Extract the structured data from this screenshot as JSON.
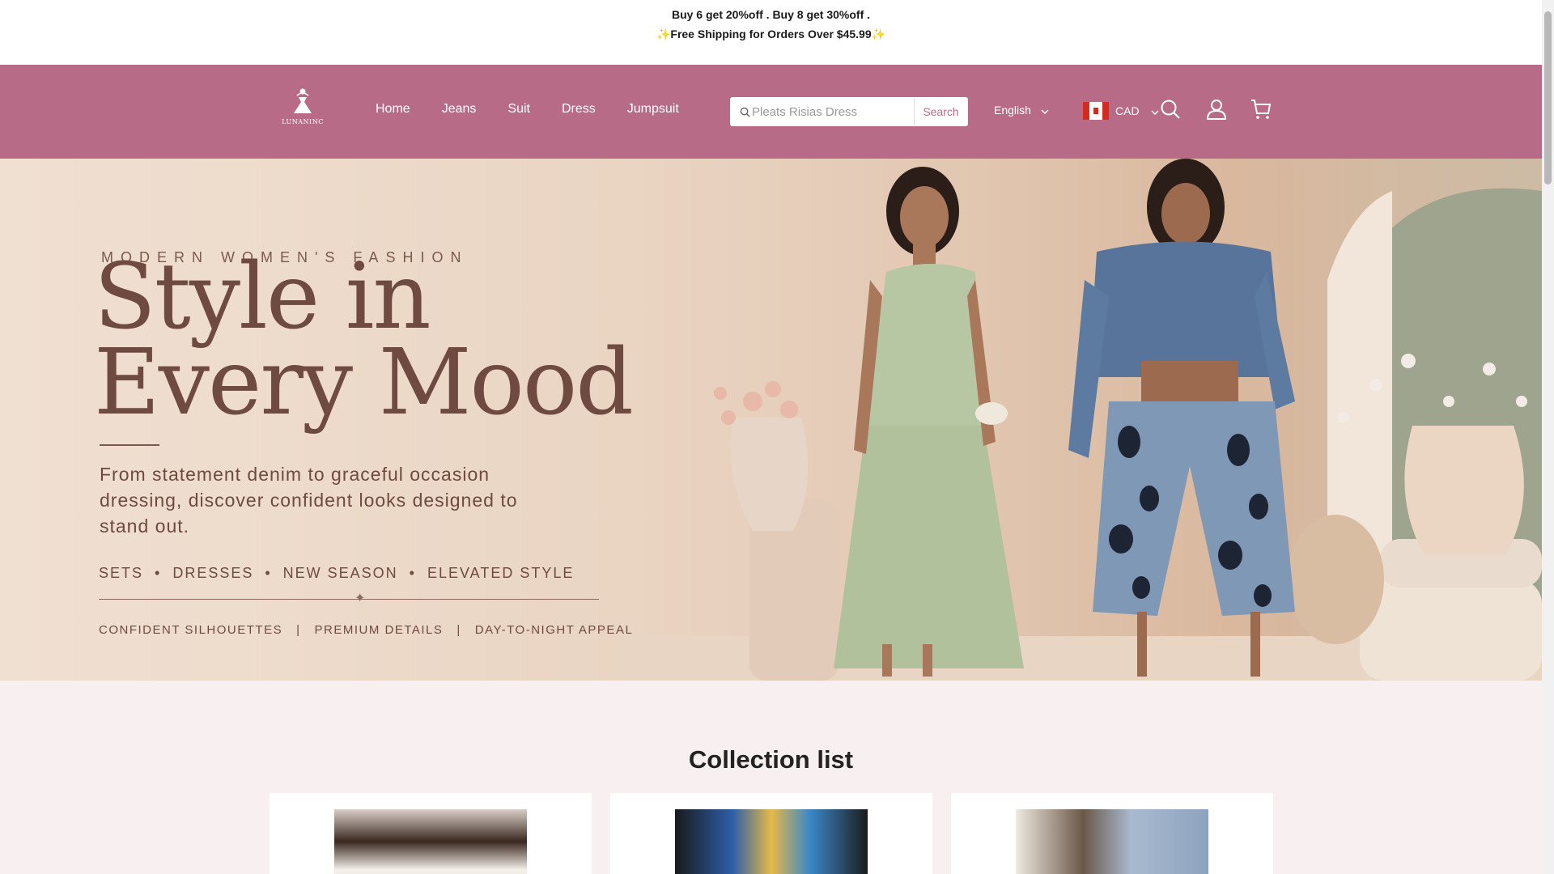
{
  "announcement": {
    "line1": "Buy 6 get 20%off . Buy 8 get 30%off .",
    "line2": "✨Free Shipping for Orders Over $45.99✨"
  },
  "header": {
    "logo_text": "LUNANINC",
    "nav": [
      "Home",
      "Jeans",
      "Suit",
      "Dress",
      "Jumpsuit"
    ],
    "search_placeholder": "Pleats Risias Dress",
    "search_button": "Search",
    "language": "English",
    "currency": "CAD",
    "colors": {
      "header_bg": "#b86b86"
    }
  },
  "hero": {
    "eyebrow": "MODERN WOMEN'S FASHION",
    "title_line1": "Style in",
    "title_line2": "Every Mood",
    "subtitle": "From statement denim to graceful occasion dressing, discover confident looks designed to stand out.",
    "tags": "SETS  •  DRESSES  •  NEW SEASON  •  ELEVATED STYLE",
    "features": "CONFIDENT SILHOUETTES   |   PREMIUM DETAILS   |   DAY-TO-NIGHT APPEAL"
  },
  "collection": {
    "title": "Collection list"
  }
}
